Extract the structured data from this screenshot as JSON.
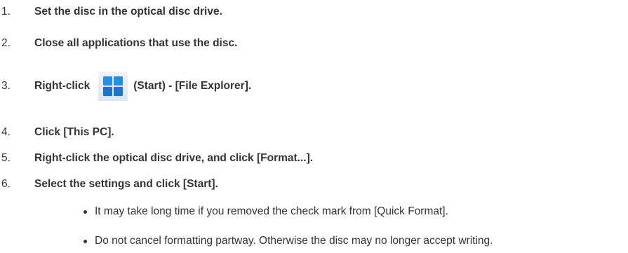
{
  "steps": [
    {
      "num": "1.",
      "text": "Set the disc in the optical disc drive."
    },
    {
      "num": "2.",
      "text": "Close all applications that use the disc."
    },
    {
      "num": "3.",
      "text_before": "Right-click",
      "icon": "windows-start-icon",
      "text_after": "(Start) - [File Explorer]."
    },
    {
      "num": "4.",
      "text": "Click [This PC]."
    },
    {
      "num": "5.",
      "text": "Right-click the optical disc drive, and click [Format...]."
    },
    {
      "num": "6.",
      "text": "Select the settings and click [Start]."
    }
  ],
  "notes": [
    "It may take long time if you removed the check mark from [Quick Format].",
    "Do not cancel formatting partway. Otherwise the disc may no longer accept writing."
  ],
  "colors": {
    "text": "#333333",
    "icon_blue": "#1e90e6"
  }
}
